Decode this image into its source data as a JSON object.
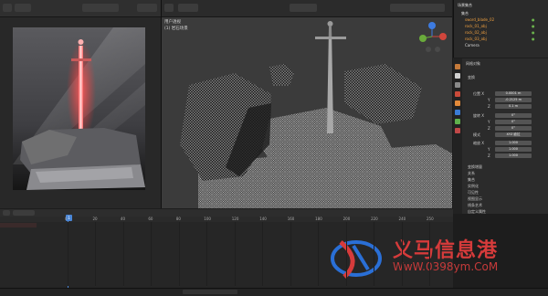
{
  "viewport": {
    "label1": "用户透视",
    "label2": "(1) 岩石场景"
  },
  "outliner": {
    "title": "场景集合",
    "items": [
      {
        "label": "集合"
      },
      {
        "label": "sword_blade_02"
      },
      {
        "label": "rock_01_obj"
      },
      {
        "label": "rock_02_obj"
      },
      {
        "label": "rock_03_obj"
      },
      {
        "label": "Camera"
      }
    ]
  },
  "properties": {
    "header": "网格对象",
    "rows": [
      {
        "label": "变换",
        "value": ""
      },
      {
        "label": "位置 X",
        "value": "0.0001 m"
      },
      {
        "label": "Y",
        "value": "-0.2125 m"
      },
      {
        "label": "Z",
        "value": "0.1 m"
      },
      {
        "label": "旋转 X",
        "value": "0°"
      },
      {
        "label": "Y",
        "value": "0°"
      },
      {
        "label": "Z",
        "value": "0°"
      },
      {
        "label": "模式",
        "value": "XYZ 欧拉"
      },
      {
        "label": "缩放 X",
        "value": "1.000"
      },
      {
        "label": "Y",
        "value": "1.000"
      },
      {
        "label": "Z",
        "value": "1.000"
      }
    ],
    "sections": [
      "变换增量",
      "关系",
      "集合",
      "实例化",
      "可见性",
      "视图显示",
      "线条艺术",
      "自定义属性"
    ]
  },
  "timeline": {
    "current_frame": "1",
    "ticks": [
      "0",
      "20",
      "40",
      "60",
      "80",
      "100",
      "120",
      "140",
      "160",
      "180",
      "200",
      "220",
      "240",
      "250"
    ]
  },
  "watermark": {
    "title": "义马信息港",
    "url": "WwW.0398ym.CoM"
  }
}
